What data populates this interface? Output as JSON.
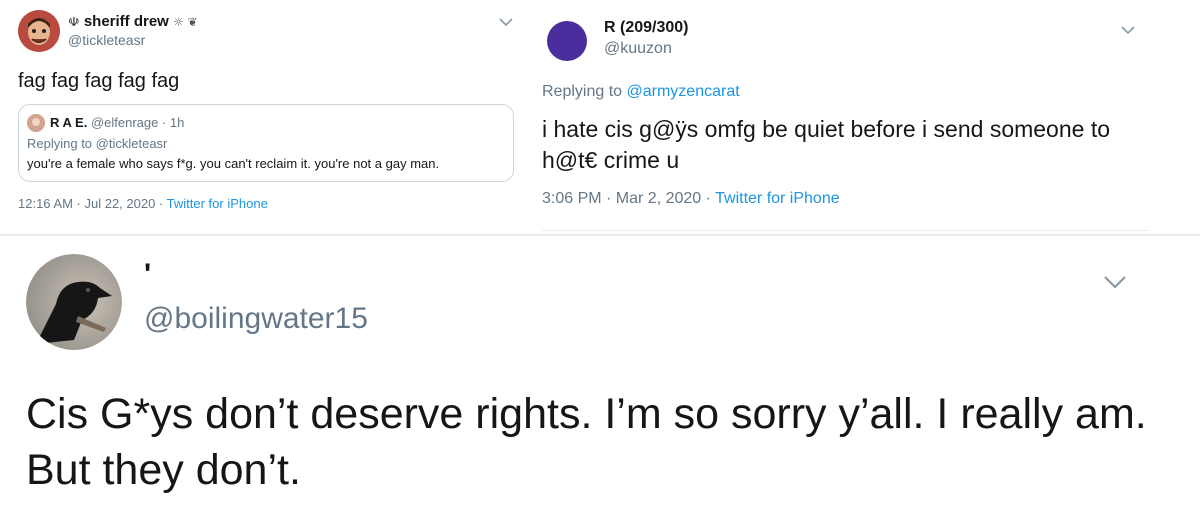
{
  "tweet1": {
    "name": "sheriff drew",
    "name_prefix_emoji": "☫",
    "name_suffix_emoji": "☼ ❦",
    "handle": "@tickleteasr",
    "text": "fag fag fag fag fag",
    "quote": {
      "name": "R A E.",
      "handle": "@elfenrage",
      "time": "· 1h",
      "replying_to_prefix": "Replying to",
      "replying_to_handle": "@tickleteasr",
      "text": "you're a female who says f*g. you can't reclaim it. you're not a gay man."
    },
    "timestamp": "12:16 AM · Jul 22, 2020 ·",
    "source": "Twitter for iPhone",
    "avatar_color": "#c0504d"
  },
  "tweet2": {
    "name": "R (209/300)",
    "handle": "@kuuzon",
    "replying_to_prefix": "Replying to",
    "replying_to_handle": "@armyzencarat",
    "text": "i hate cis g@ÿs omfg be quiet before i send someone to h@t€ crime u",
    "timestamp": "3:06 PM · Mar 2, 2020 ·",
    "source": "Twitter for iPhone",
    "avatar_color": "#4b2e9e"
  },
  "tweet3": {
    "name": "'",
    "handle": "@boilingwater15",
    "text": "Cis G*ys don’t deserve rights. I’m so sorry y’all. I really am. But they don’t."
  },
  "icons": {
    "chevron": "chevron-down-icon"
  },
  "colors": {
    "link": "#1b95e0",
    "muted": "#657786",
    "border": "#ccd6dd"
  }
}
